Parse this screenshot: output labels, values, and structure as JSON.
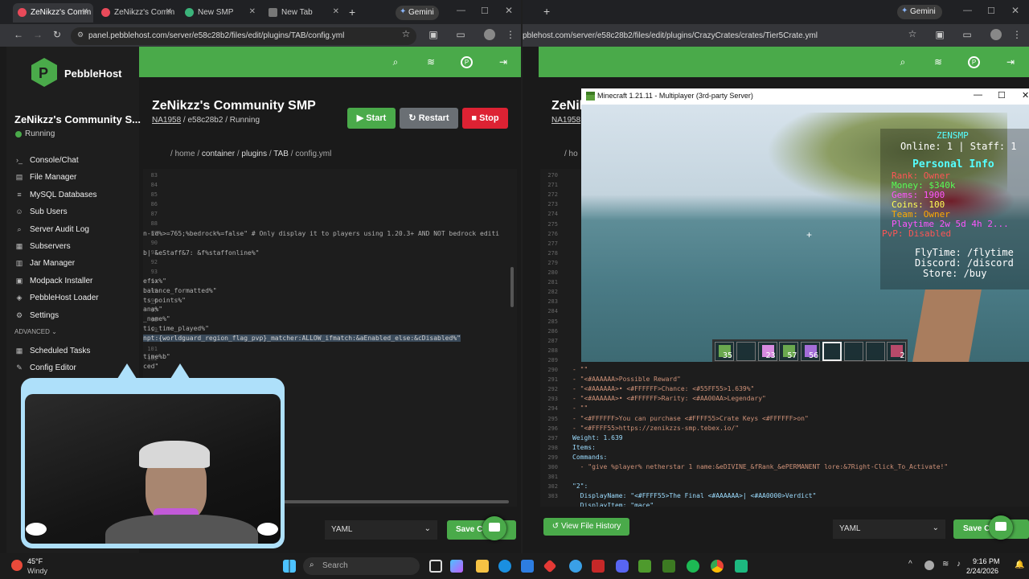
{
  "left_browser": {
    "tabs": [
      "ZeNikzz's Comm",
      "ZeNikzz's Comm",
      "New SMP",
      "New Tab"
    ],
    "gemini_label": "Gemini",
    "url": "panel.pebblehost.com/server/e58c28b2/files/edit/plugins/TAB/config.yml"
  },
  "right_browser": {
    "gemini_label": "Gemini",
    "url": "pblehost.com/server/e58c28b2/files/edit/plugins/CrazyCrates/crates/Tier5Crate.yml"
  },
  "brand": {
    "name": "PebbleHost",
    "color": "#4aaa4a"
  },
  "server": {
    "name": "ZeNikzz's Community SMP",
    "sidebar_name": "ZeNikzz's Community S...",
    "status": "Running",
    "node": "NA1958",
    "id": "e58c28b2",
    "right_title": "ZeNikz",
    "right_node": "NA1958"
  },
  "buttons": {
    "start": "Start",
    "restart": "Restart",
    "stop": "Stop",
    "save": "Save C",
    "file_history": "View File History"
  },
  "breadcrumb": [
    "home",
    "container",
    "plugins",
    "TAB",
    "config.yml"
  ],
  "right_breadcrumb_start": "/ ho",
  "nav": [
    {
      "label": "Console/Chat",
      "icon": "terminal-icon"
    },
    {
      "label": "File Manager",
      "icon": "file-icon"
    },
    {
      "label": "MySQL Databases",
      "icon": "database-icon"
    },
    {
      "label": "Sub Users",
      "icon": "users-icon"
    },
    {
      "label": "Server Audit Log",
      "icon": "search-icon"
    },
    {
      "label": "Subservers",
      "icon": "servers-icon"
    },
    {
      "label": "Jar Manager",
      "icon": "jar-icon"
    },
    {
      "label": "Modpack Installer",
      "icon": "package-icon"
    },
    {
      "label": "PebbleHost Loader",
      "icon": "loader-icon"
    },
    {
      "label": "Settings",
      "icon": "gear-icon"
    }
  ],
  "advanced_label": "ADVANCED",
  "advanced_nav": [
    {
      "label": "Scheduled Tasks",
      "icon": "calendar-icon"
    },
    {
      "label": "Config Editor",
      "icon": "edit-icon"
    }
  ],
  "left_code": {
    "line_numbers": [
      "83",
      "84",
      "85",
      "86",
      "87",
      "88",
      "89",
      "90",
      "91",
      "92",
      "93",
      "94",
      "95",
      "96",
      "97",
      "98",
      "99",
      "100",
      "101",
      "102"
    ],
    "lines": [
      "n-id%>=765;%bedrock%=false\" # Only display it to players using 1.20.3+ AND NOT bedrock editi",
      "",
      "b| &eStaff&7: &f%staffonline%\"",
      "",
      "",
      "efix%\"",
      "balance_formatted%\"",
      "ts_points%\"",
      "ana%\"",
      "_name%\"",
      "tic_time_played%\"",
      "npt:{worldguard_region_flag_pvp}_matcher:ALLOW_ifmatch:&aEnabled_else:&cDisabled%\"",
      "",
      "time%b\"",
      "ced\""
    ]
  },
  "right_code": {
    "line_numbers": [
      "270",
      "271",
      "272",
      "273",
      "274",
      "275",
      "276",
      "277",
      "278",
      "279",
      "280",
      "281",
      "282",
      "283",
      "284",
      "285",
      "286",
      "287",
      "288",
      "289",
      "290",
      "291",
      "292",
      "293",
      "294",
      "295",
      "296",
      "297",
      "298",
      "299",
      "300",
      "301",
      "302",
      "303"
    ],
    "lines": [
      "- \"\"",
      "- \"<#AAAAAA>Possible Reward\"",
      "- \"<#AAAAAA>• <#FFFFFF>Chance: <#55FF55>1.639%\"",
      "- \"<#AAAAAA>• <#FFFFFF>Rarity: <#AA00AA>Legendary\"",
      "- \"\"",
      "- \"<#FFFFFF>You can purchase <#FFFF55>Crate Keys <#FFFFFF>on\"",
      "- \"<#FFFF55>https://zenikzzs-smp.tebex.io/\"",
      "Weight: 1.639",
      "Items:",
      "Commands:",
      "  - \"give %player% netherstar 1 name:&eDIVINE_&fRank_&ePERMANENT lore:&7Right-Click_To_Activate!\"",
      "",
      "\"2\":",
      "  DisplayName: \"<#FFFF55>The Final <#AAAAAA>| <#AA0000>Verdict\"",
      "  DisplayItem: \"mace\""
    ]
  },
  "language_select": "YAML",
  "minecraft": {
    "window_title": "Minecraft 1.21.11 - Multiplayer (3rd-party Server)",
    "server_name": "ZENSMP",
    "online_line": "Online: 1 | Staff: 1",
    "personal_info": "Personal Info",
    "rank": "Rank: Owner",
    "money": "Money: $340k",
    "line3": "Gems: 1900",
    "line4": "Coins: 100",
    "team": "Team: Owner",
    "playtime": "Playtime 2w 5d 4h 2...",
    "pvp": "PvP: Disabled",
    "flytime": "FlyTime: /flytime",
    "discord": "Discord: /discord",
    "store": "Store: /buy",
    "hotbar_counts": [
      "35",
      "",
      "23",
      "57",
      "56",
      "",
      "",
      "",
      "2"
    ]
  },
  "taskbar": {
    "weather_temp": "45°F",
    "weather_desc": "Windy",
    "search_placeholder": "Search",
    "time": "9:16 PM",
    "date": "2/24/2026"
  }
}
